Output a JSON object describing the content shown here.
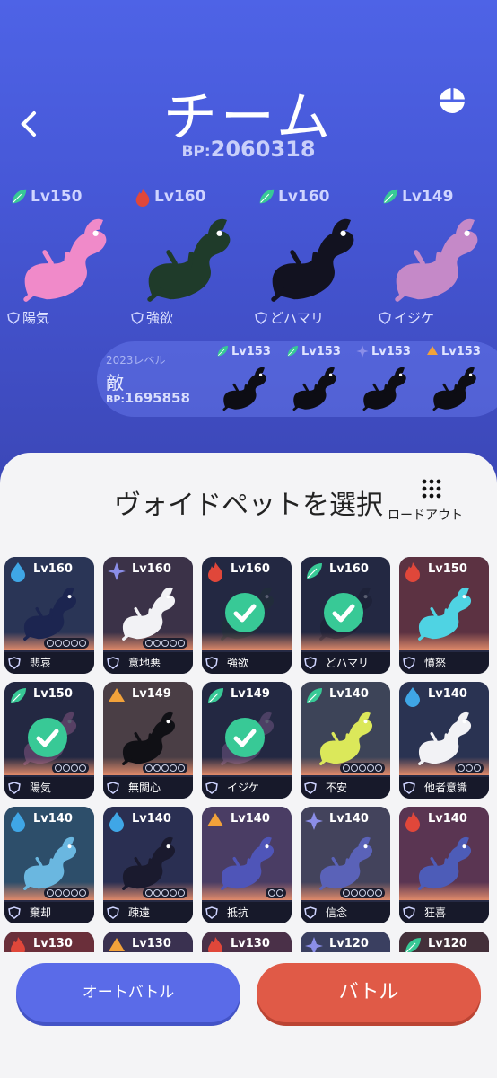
{
  "header": {
    "title": "チーム",
    "bp_label": "BP:",
    "bp_value": "2060318"
  },
  "team": [
    {
      "level": "Lv150",
      "element": "leaf",
      "trait": "陽気",
      "color": "#f08ac9"
    },
    {
      "level": "Lv160",
      "element": "fire",
      "trait": "強欲",
      "color": "#1f3b2a"
    },
    {
      "level": "Lv160",
      "element": "leaf",
      "trait": "どハマリ",
      "color": "#121220"
    },
    {
      "level": "Lv149",
      "element": "leaf",
      "trait": "イジケ",
      "color": "#c589c8"
    }
  ],
  "enemy": {
    "year_label": "2023レベル",
    "label": "敵",
    "bp_label": "BP:",
    "bp_value": "1695858",
    "pets": [
      {
        "level": "Lv153",
        "element": "leaf"
      },
      {
        "level": "Lv153",
        "element": "leaf"
      },
      {
        "level": "Lv153",
        "element": "star"
      },
      {
        "level": "Lv153",
        "element": "earth"
      }
    ]
  },
  "select": {
    "title": "ヴォイドペットを選択",
    "loadout_label": "ロードアウト"
  },
  "cards": [
    {
      "level": "Lv160",
      "element": "water",
      "name": "悲哀",
      "selected": false,
      "bg": "#2a3556",
      "stars": 5,
      "art": "#1c2550"
    },
    {
      "level": "Lv160",
      "element": "star",
      "name": "意地悪",
      "selected": false,
      "bg": "#3b3248",
      "stars": 5,
      "art": "#f2f2f5"
    },
    {
      "level": "Lv160",
      "element": "fire",
      "name": "強欲",
      "selected": true,
      "bg": "#232842",
      "stars": 0,
      "art": "#1f3b2a"
    },
    {
      "level": "Lv160",
      "element": "leaf",
      "name": "どハマリ",
      "selected": true,
      "bg": "#232842",
      "stars": 0,
      "art": "#121220"
    },
    {
      "level": "Lv150",
      "element": "fire",
      "name": "憤怒",
      "selected": false,
      "bg": "#5c3242",
      "stars": 0,
      "art": "#4fd3e3"
    },
    {
      "level": "Lv150",
      "element": "leaf",
      "name": "陽気",
      "selected": true,
      "bg": "#232842",
      "stars": 4,
      "art": "#f08ac9"
    },
    {
      "level": "Lv149",
      "element": "earth",
      "name": "無関心",
      "selected": false,
      "bg": "#4a3e45",
      "stars": 5,
      "art": "#101015"
    },
    {
      "level": "Lv149",
      "element": "leaf",
      "name": "イジケ",
      "selected": true,
      "bg": "#232842",
      "stars": 0,
      "art": "#c589c8"
    },
    {
      "level": "Lv140",
      "element": "leaf",
      "name": "不安",
      "selected": false,
      "bg": "#3d4458",
      "stars": 5,
      "art": "#dbe85a"
    },
    {
      "level": "Lv140",
      "element": "water",
      "name": "他者意識",
      "selected": false,
      "bg": "#2a3352",
      "stars": 3,
      "art": "#f2f2f5"
    },
    {
      "level": "Lv140",
      "element": "water",
      "name": "棄却",
      "selected": false,
      "bg": "#2d4e6a",
      "stars": 5,
      "art": "#6ab7e0"
    },
    {
      "level": "Lv140",
      "element": "water",
      "name": "疎遠",
      "selected": false,
      "bg": "#2a2f52",
      "stars": 5,
      "art": "#1a1a2e"
    },
    {
      "level": "Lv140",
      "element": "earth",
      "name": "抵抗",
      "selected": false,
      "bg": "#4a3d64",
      "stars": 2,
      "art": "#4f55b8"
    },
    {
      "level": "Lv140",
      "element": "star",
      "name": "信念",
      "selected": false,
      "bg": "#43435c",
      "stars": 5,
      "art": "#5a62b8"
    },
    {
      "level": "Lv140",
      "element": "fire",
      "name": "狂喜",
      "selected": false,
      "bg": "#5a3552",
      "stars": 0,
      "art": "#4d5cb8"
    },
    {
      "level": "Lv130",
      "element": "fire",
      "name": "",
      "selected": false,
      "bg": "#6a2f3a",
      "stars": 0,
      "art": "#6a2f3a"
    },
    {
      "level": "Lv130",
      "element": "earth",
      "name": "",
      "selected": false,
      "bg": "#3a3150",
      "stars": 0,
      "art": "#3a3150"
    },
    {
      "level": "Lv130",
      "element": "fire",
      "name": "",
      "selected": false,
      "bg": "#4a3048",
      "stars": 0,
      "art": "#4a3048"
    },
    {
      "level": "Lv120",
      "element": "star",
      "name": "",
      "selected": false,
      "bg": "#3a3f60",
      "stars": 0,
      "art": "#3a3f60"
    },
    {
      "level": "Lv120",
      "element": "leaf",
      "name": "",
      "selected": false,
      "bg": "#44303a",
      "stars": 0,
      "art": "#44303a"
    }
  ],
  "buttons": {
    "auto_battle": "オートバトル",
    "battle": "バトル"
  },
  "colors": {
    "leaf": "#38c996",
    "fire": "#e0473a",
    "water": "#3fa6e6",
    "star": "#8b8ee8",
    "earth": "#f2a23a"
  }
}
